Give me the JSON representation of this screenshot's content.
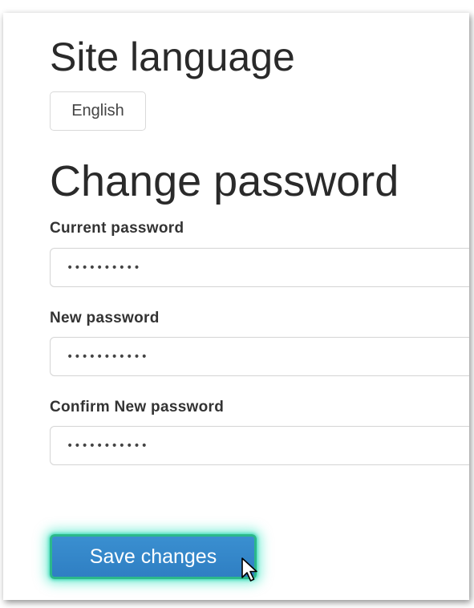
{
  "site_language": {
    "heading": "Site language",
    "selected_language": "English"
  },
  "change_password": {
    "heading": "Change password",
    "current": {
      "label": "Current password",
      "value": "••••••••••"
    },
    "new": {
      "label": "New password",
      "value": "•••••••••••"
    },
    "confirm": {
      "label": "Confirm New password",
      "value": "•••••••••••"
    },
    "save_label": "Save changes"
  },
  "cursor": {
    "icon": "mouse-pointer-icon"
  },
  "colors": {
    "button_blue": "#3a8fd0",
    "highlight_glow": "#34e6c3"
  }
}
